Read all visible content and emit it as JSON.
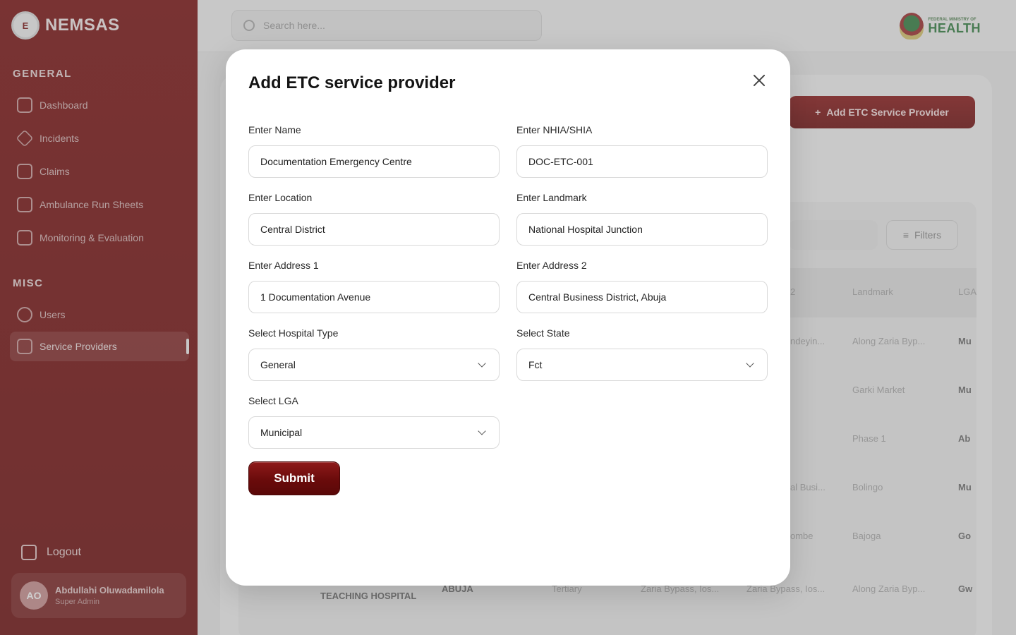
{
  "sidebar": {
    "brand": "NEMSAS",
    "brand_logo_text": "E",
    "section_general": "GENERAL",
    "section_misc": "MISC",
    "general_items": [
      {
        "label": "Dashboard",
        "icon": "grid-icon"
      },
      {
        "label": "Incidents",
        "icon": "diamond-icon"
      },
      {
        "label": "Claims",
        "icon": "clipboard-icon"
      },
      {
        "label": "Ambulance Run Sheets",
        "icon": "ambulance-icon"
      },
      {
        "label": "Monitoring & Evaluation",
        "icon": "bar-chart-icon"
      }
    ],
    "misc_items": [
      {
        "label": "Users",
        "icon": "users-icon"
      },
      {
        "label": "Service Providers",
        "icon": "hospital-icon",
        "active": true
      }
    ],
    "logout": "Logout",
    "user": {
      "initials": "AO",
      "name": "Abdullahi Oluwadamilola",
      "role": "Super Admin"
    }
  },
  "topbar": {
    "search_placeholder": "Search here...",
    "ministry_small": "FEDERAL MINISTRY OF",
    "ministry_big": "HEALTH"
  },
  "background": {
    "add_button": "Add ETC Service Provider",
    "filters": "Filters",
    "header_cells": [
      "2",
      "Landmark",
      "LGA"
    ],
    "rows": [
      [
        "ndeyin...",
        "Along Zaria Byp...",
        "Mu"
      ],
      [
        "",
        "Garki Market",
        "Mu"
      ],
      [
        "",
        "Phase 1",
        "Ab"
      ],
      [
        "al Busi...",
        "Bolingo",
        "Mu"
      ],
      [
        "ombe",
        "Bajoga",
        "Go"
      ]
    ],
    "last_row": [
      "TEACHING HOSPITAL",
      "ABUJA",
      "Tertiary",
      "Zaria Bypass, Ios...",
      "Zaria Bypass, Ios...",
      "Along Zaria Byp...",
      "Gw"
    ]
  },
  "modal": {
    "title": "Add ETC service provider",
    "fields": {
      "name": {
        "label": "Enter Name",
        "value": "Documentation Emergency Centre"
      },
      "nhia": {
        "label": "Enter NHIA/SHIA",
        "value": "DOC-ETC-001"
      },
      "location": {
        "label": "Enter Location",
        "value": "Central District"
      },
      "landmark": {
        "label": "Enter Landmark",
        "value": "National Hospital Junction"
      },
      "address1": {
        "label": "Enter Address 1",
        "value": "1 Documentation Avenue"
      },
      "address2": {
        "label": "Enter Address 2",
        "value": "Central Business District, Abuja"
      },
      "hospital_type": {
        "label": "Select Hospital Type",
        "value": "General"
      },
      "state": {
        "label": "Select State",
        "value": "Fct"
      },
      "lga": {
        "label": "Select LGA",
        "value": "Municipal"
      }
    },
    "submit": "Submit"
  },
  "colors": {
    "brand_primary": "#7a0e0e",
    "ministry_green": "#2f7d3e"
  }
}
